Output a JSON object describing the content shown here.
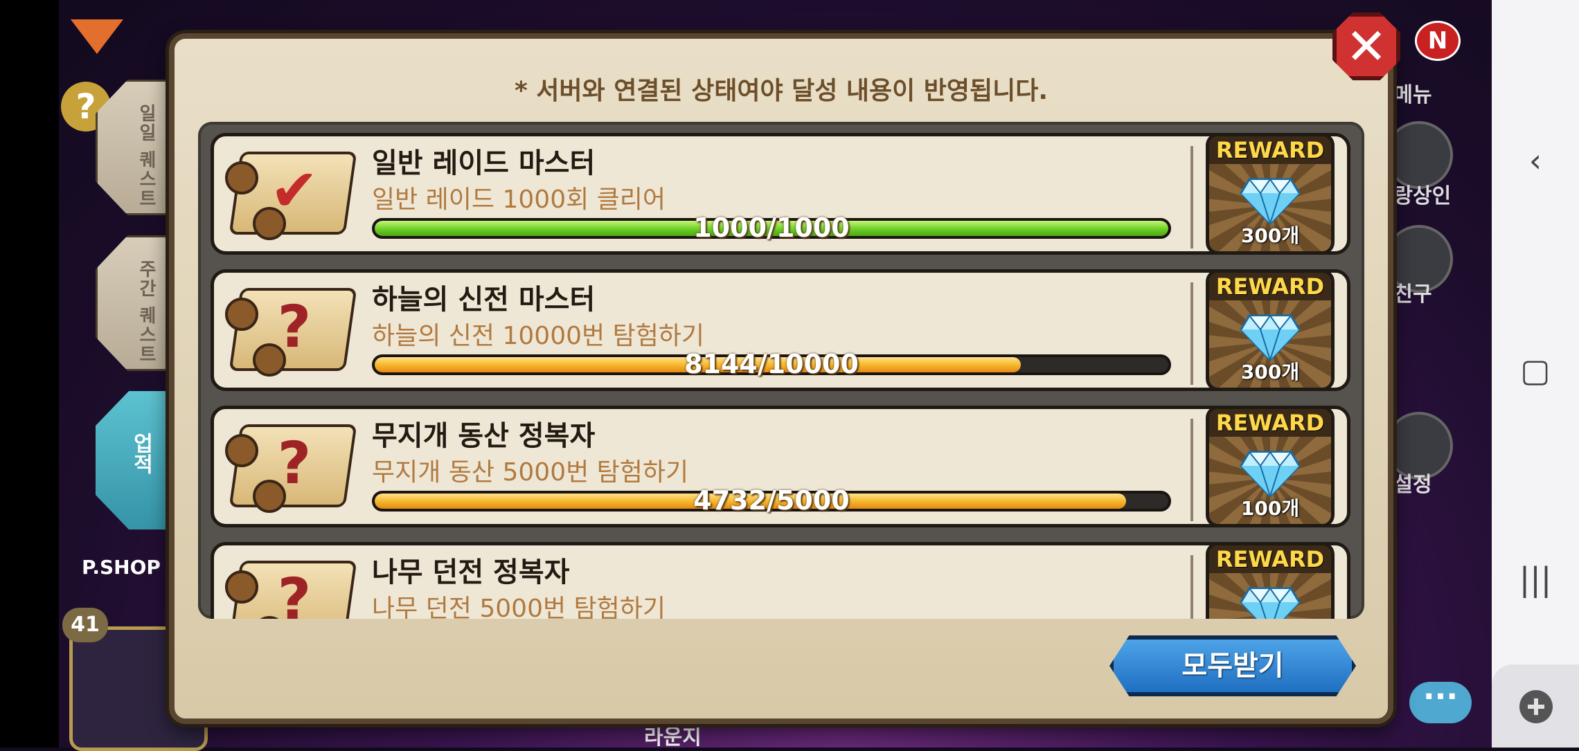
{
  "notice": "* 서버와 연결된 상태여야 달성 내용이 반영됩니다.",
  "reward_label": "REWARD",
  "claim_all_label": "모두받기",
  "quests": [
    {
      "title": "일반 레이드 마스터",
      "description": "일반 레이드 1000회 클리어",
      "progress_text": "1000/1000",
      "progress": 1.0,
      "status": "complete",
      "reward_amount": "300개",
      "icon": "scroll-check-icon"
    },
    {
      "title": "하늘의 신전 마스터",
      "description": "하늘의 신전 10000번 탐험하기",
      "progress_text": "8144/10000",
      "progress": 0.8144,
      "status": "in-progress",
      "reward_amount": "300개",
      "icon": "scroll-question-icon"
    },
    {
      "title": "무지개 동산 정복자",
      "description": "무지개 동산 5000번 탐험하기",
      "progress_text": "4732/5000",
      "progress": 0.9464,
      "status": "in-progress",
      "reward_amount": "100개",
      "icon": "scroll-question-icon"
    },
    {
      "title": "나무 던전 정복자",
      "description": "나무 던전 5000번 탐험하기",
      "progress_text": "",
      "progress": null,
      "status": "in-progress",
      "reward_amount": "",
      "icon": "scroll-question-icon"
    }
  ],
  "side_tabs": {
    "daily": "일일 퀘스트",
    "weekly": "주간 퀘스트",
    "active": "업적"
  },
  "right_menu": {
    "menu": "메뉴",
    "merchant": "방랑상인",
    "friends": "친구",
    "settings": "설정",
    "new_badge": "N"
  },
  "background": {
    "pshop": "P.SHOP",
    "level": "41",
    "lounge": "라운지"
  },
  "colors": {
    "complete_bar": "#6ccf26",
    "progress_bar": "#f5b42a",
    "close_button": "#d03232",
    "claim_button": "#1f6fc1"
  }
}
